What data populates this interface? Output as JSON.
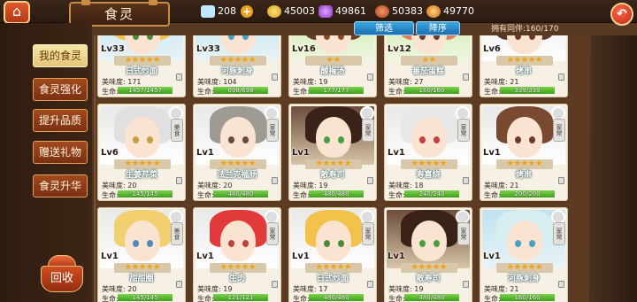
{
  "header": {
    "title": "食灵",
    "home_icon": "home-icon",
    "back_icon": "back-arrow-icon"
  },
  "resources": [
    {
      "name": "diamond",
      "icon": "diamond-icon",
      "value": "208",
      "has_plus": true,
      "color": "#bfe7ff"
    },
    {
      "name": "gold",
      "icon": "gold-coin-icon",
      "value": "45003",
      "color": "#f3c13a"
    },
    {
      "name": "crystal",
      "icon": "purple-crystal-icon",
      "value": "49861",
      "color": "#b968e8"
    },
    {
      "name": "meat",
      "icon": "meat-icon",
      "value": "50383",
      "color": "#d8643a"
    },
    {
      "name": "stew",
      "icon": "stew-pot-icon",
      "value": "49770",
      "color": "#f08a2a"
    }
  ],
  "toolbar": {
    "filter_label": "筛选",
    "sort_label": "降序",
    "owned_label": "拥有同伴:160/170"
  },
  "sidebar": {
    "items": [
      {
        "label": "我的食灵",
        "active": true
      },
      {
        "label": "食灵强化"
      },
      {
        "label": "提升品质"
      },
      {
        "label": "赠送礼物"
      },
      {
        "label": "食灵升华"
      }
    ],
    "recycle_label": "回收"
  },
  "cards": [
    {
      "level": "Lv33",
      "stars": "★★★★★",
      "name": "日式炒面",
      "taste": "美味度: 171",
      "hp": "1457/1457",
      "hp_frac": 1.0,
      "tone": "blue",
      "hair": "#f2c24a",
      "eye": "#4a8a3a",
      "badge": ""
    },
    {
      "level": "Lv33",
      "stars": "★★★★★",
      "name": "河豚刺身",
      "taste": "美味度: 104",
      "hp": "698/698",
      "hp_frac": 1.0,
      "tone": "blue",
      "hair": "#d7eef0",
      "eye": "#4aa0c0",
      "badge": ""
    },
    {
      "level": "Lv16",
      "stars": "★★",
      "name": "酸梅汤",
      "taste": "美味度: 19",
      "hp": "177/177",
      "hp_frac": 1.0,
      "tone": "green",
      "hair": "#6b3a2a",
      "eye": "#8a4a2a",
      "badge": ""
    },
    {
      "level": "Lv12",
      "stars": "★★",
      "name": "番茄蛋糕",
      "taste": "美味度: 27",
      "hp": "160/160",
      "hp_frac": 1.0,
      "tone": "green",
      "hair": "#e37a5a",
      "eye": "#6a3a2a",
      "badge": ""
    },
    {
      "level": "Lv6",
      "stars": "★★★★★",
      "name": "烤串",
      "taste": "美味度: 21",
      "hp": "339/339",
      "hp_frac": 1.0,
      "tone": "gray",
      "hair": "#5a3a2a",
      "eye": "#6a3a2a",
      "badge": ""
    },
    {
      "level": "Lv6",
      "stars": "★★★★★",
      "name": "生姜芹菜",
      "taste": "美味度: 20",
      "hp": "145/145",
      "hp_frac": 1.0,
      "tone": "gray",
      "hair": "#e0e0e0",
      "eye": "#c0a040",
      "badge": "美食"
    },
    {
      "level": "Lv1",
      "stars": "★★★★★",
      "name": "法兰克福肠",
      "taste": "美味度: 20",
      "hp": "480/480",
      "hp_frac": 1.0,
      "tone": "gray",
      "hair": "#a09a94",
      "eye": "#6a4a3a",
      "badge": "家常"
    },
    {
      "level": "Lv1",
      "stars": "★★★★★",
      "name": "散寿司",
      "taste": "美味度: 19",
      "hp": "480/480",
      "hp_frac": 1.0,
      "tone": "brown",
      "hair": "#3a2218",
      "eye": "#4aa040",
      "badge": "家常"
    },
    {
      "level": "Lv1",
      "stars": "★★★★★",
      "name": "寿喜烧",
      "taste": "美味度: 18",
      "hp": "240/240",
      "hp_frac": 1.0,
      "tone": "gray",
      "hair": "#e8e8e8",
      "eye": "#c04040",
      "badge": "家常"
    },
    {
      "level": "Lv1",
      "stars": "★★★★★",
      "name": "烤串",
      "taste": "美味度: 21",
      "hp": "200/200",
      "hp_frac": 1.0,
      "tone": "gray",
      "hair": "#7a4a30",
      "eye": "#6a3a2a",
      "badge": "家常"
    },
    {
      "level": "Lv1",
      "stars": "★★★★★",
      "name": "甜甜圈",
      "taste": "美味度: 20",
      "hp": "145/145",
      "hp_frac": 1.0,
      "tone": "gray",
      "hair": "#f2d070",
      "eye": "#4a8ac0",
      "badge": "美食"
    },
    {
      "level": "Lv1",
      "stars": "★★★★★",
      "name": "生肉",
      "taste": "美味度: 19",
      "hp": "121/121",
      "hp_frac": 1.0,
      "tone": "gray",
      "hair": "#e23a3a",
      "eye": "#c04040",
      "badge": "家常"
    },
    {
      "level": "Lv1",
      "stars": "★★★★★",
      "name": "日式炒面",
      "taste": "美味度: 17",
      "hp": "480/480",
      "hp_frac": 1.0,
      "tone": "gray",
      "hair": "#f2c24a",
      "eye": "#4a8a3a",
      "badge": "家常"
    },
    {
      "level": "Lv1",
      "stars": "★★★★★",
      "name": "散寿司",
      "taste": "美味度: 19",
      "hp": "480/480",
      "hp_frac": 1.0,
      "tone": "brown",
      "hair": "#3a2218",
      "eye": "#4aa040",
      "badge": "家常"
    },
    {
      "level": "Lv1",
      "stars": "★★★★★",
      "name": "河豚刺身",
      "taste": "美味度: 21",
      "hp": "160/160",
      "hp_frac": 1.0,
      "tone": "blue",
      "hair": "#d7eef0",
      "eye": "#4aa0c0",
      "badge": "家常"
    }
  ],
  "labels": {
    "taste_prefix": "美味度:",
    "hp_prefix": "生命:"
  }
}
